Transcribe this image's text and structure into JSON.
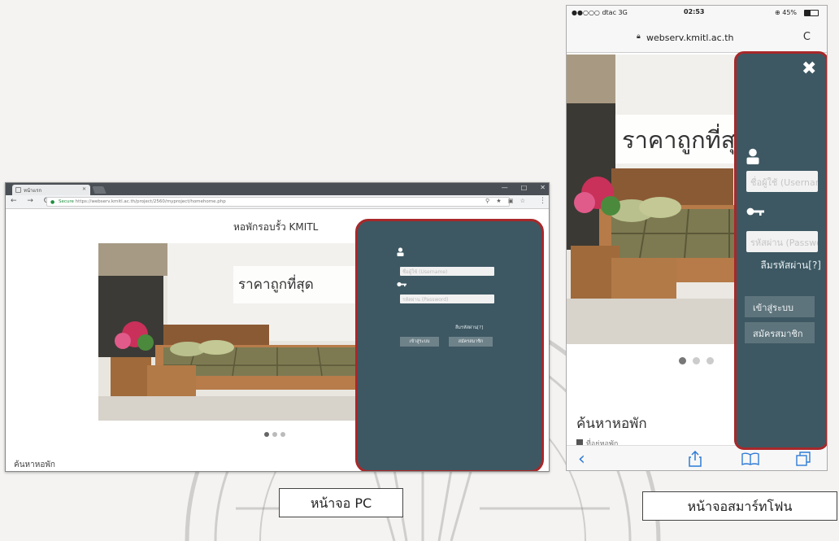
{
  "pc": {
    "tab_title": "หน้าแรก",
    "window_buttons": [
      "—",
      "□",
      "✕"
    ],
    "nav_glyphs": "← → C",
    "secure_label": "Secure",
    "url": "https://webserv.kmitl.ac.th/project/2560/myproject/homehome.php",
    "url_tools": "⚲ ★ ▣ ☆",
    "site_title": "หอพักรอบรั้ว KMITL",
    "slogan": "ราคาถูกที่สุด",
    "login": {
      "username_placeholder": "ชื่อผู้ใช้ (Username)",
      "password_placeholder": "รหัสผ่าน (Password)",
      "forgot_label": "ลืมรหัสผ่าน[?]",
      "login_button": "เข้าสู่ระบบ",
      "register_button": "สมัครสมาชิก"
    },
    "search_heading": "ค้นหาหอพัก",
    "carousel_active": 1
  },
  "phone": {
    "carrier": "●●○○○ dtac  3G",
    "time": "02:53",
    "battery": "⊕ 45%",
    "url": "webserv.kmitl.ac.th",
    "reload_glyph": "C",
    "slogan": "ราคาถูกที่สุด",
    "login": {
      "close_glyph": "✖",
      "username_placeholder": "ชื่อผู้ใช้ (Username)",
      "password_placeholder": "รหัสผ่าน (Password)",
      "forgot_label": "ลืมรหัสผ่าน[?]",
      "login_button": "เข้าสู่ระบบ",
      "register_button": "สมัครสมาชิก"
    },
    "search_heading": "ค้นหาหอพัก",
    "search_sub": "ที่อยู่หอพัก",
    "toolbar_glyphs": {
      "back": "‹"
    },
    "carousel_active": 1
  },
  "captions": {
    "pc": "หน้าจอ PC",
    "phone": "หน้าจอสมาร์ทโฟน"
  },
  "colors": {
    "panel": "#3d5863",
    "highlight_border": "#a8282a",
    "page_bg": "#f4f3f1"
  }
}
